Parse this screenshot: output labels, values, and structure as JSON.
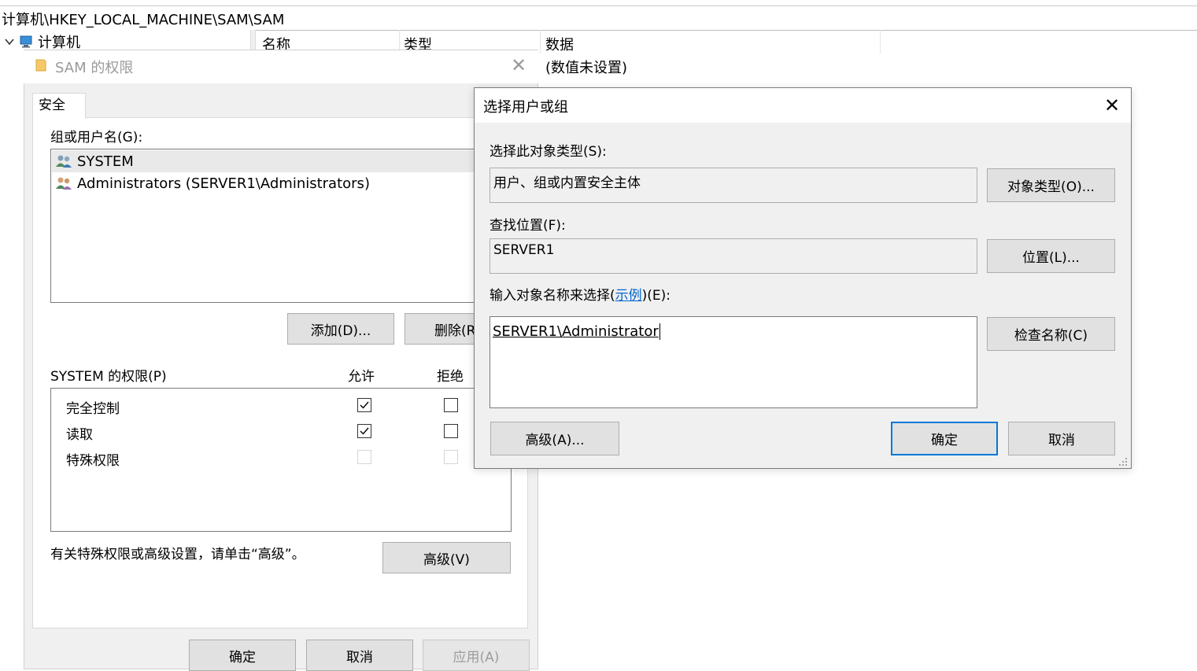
{
  "registry": {
    "address": "计算机\\HKEY_LOCAL_MACHINE\\SAM\\SAM",
    "tree_root": "计算机",
    "columns": [
      "名称",
      "类型",
      "数据"
    ],
    "row_data": "(数值未设置)"
  },
  "perm_dialog": {
    "title": "SAM 的权限",
    "tab": "安全",
    "group_label": "组或用户名(G):",
    "users": [
      "SYSTEM",
      "Administrators (SERVER1\\Administrators)"
    ],
    "add_button": "添加(D)...",
    "remove_button": "删除(R)",
    "perm_header": "SYSTEM 的权限(P)",
    "allow_header": "允许",
    "deny_header": "拒绝",
    "permissions": [
      {
        "label": "完全控制",
        "allow": true,
        "deny": false
      },
      {
        "label": "读取",
        "allow": true,
        "deny": false
      },
      {
        "label": "特殊权限",
        "allow": false,
        "deny": false
      }
    ],
    "note": "有关特殊权限或高级设置，请单击“高级”。",
    "advanced_button": "高级(V)",
    "ok": "确定",
    "cancel": "取消",
    "apply": "应用(A)"
  },
  "select_dialog": {
    "title": "选择用户或组",
    "object_type_label": "选择此对象类型(S):",
    "object_type_value": "用户、组或内置安全主体",
    "object_type_button": "对象类型(O)...",
    "location_label": "查找位置(F):",
    "location_value": "SERVER1",
    "location_button": "位置(L)...",
    "name_label_prefix": "输入对象名称来选择(",
    "name_label_link": "示例",
    "name_label_suffix": ")(E):",
    "name_value": "SERVER1\\Administrator",
    "check_names_button": "检查名称(C)",
    "advanced_button": "高级(A)...",
    "ok": "确定",
    "cancel": "取消"
  },
  "colors": {
    "accent": "#0078d7",
    "link": "#0066cc",
    "dialog_bg": "#f0f0f0"
  }
}
